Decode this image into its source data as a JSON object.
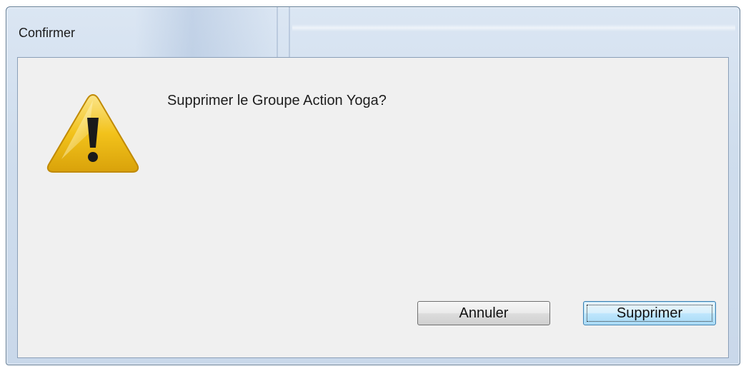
{
  "dialog": {
    "title": "Confirmer",
    "message": "Supprimer le Groupe Action Yoga?",
    "icon": "warning-icon"
  },
  "buttons": {
    "cancel_label": "Annuler",
    "delete_label": "Supprimer"
  },
  "colors": {
    "client_background": "#f0f0f0",
    "default_button_border": "#3c7fb1",
    "warning_yellow": "#f2c21b"
  }
}
